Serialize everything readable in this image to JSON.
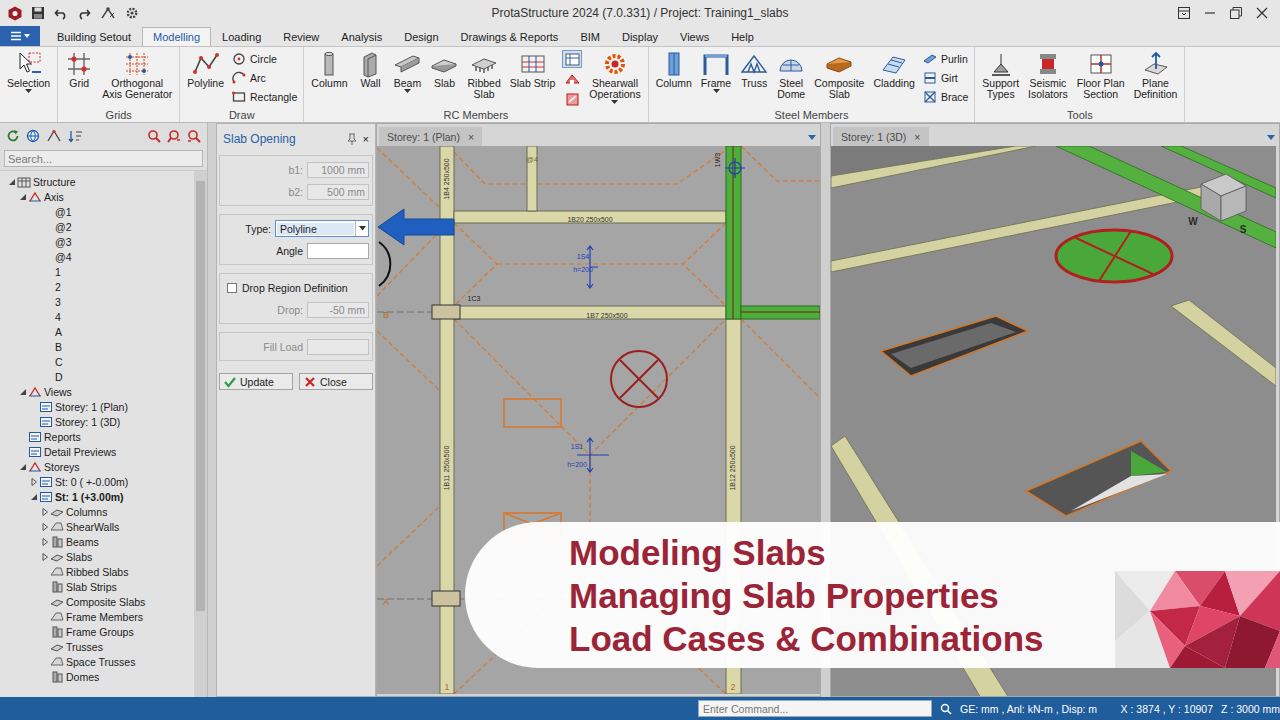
{
  "window": {
    "title": "ProtaStructure 2024 (7.0.331) / Project: Training1_slabs"
  },
  "menu_tabs": [
    {
      "label": "Building Setout",
      "selected": false
    },
    {
      "label": "Modelling",
      "selected": true
    },
    {
      "label": "Loading",
      "selected": false
    },
    {
      "label": "Review",
      "selected": false
    },
    {
      "label": "Analysis",
      "selected": false
    },
    {
      "label": "Design",
      "selected": false
    },
    {
      "label": "Drawings & Reports",
      "selected": false
    },
    {
      "label": "BIM",
      "selected": false
    },
    {
      "label": "Display",
      "selected": false
    },
    {
      "label": "Views",
      "selected": false
    },
    {
      "label": "Help",
      "selected": false
    }
  ],
  "ribbon_groups": [
    {
      "title": "",
      "items": [
        {
          "kind": "large",
          "lines": [
            "Selection"
          ],
          "dropdown": true
        }
      ]
    },
    {
      "title": "Grids",
      "items": [
        {
          "kind": "large",
          "lines": [
            "Grid"
          ],
          "dropdown": false
        },
        {
          "kind": "large",
          "lines": [
            "Orthogonal",
            "Axis Generator"
          ],
          "dropdown": false
        }
      ]
    },
    {
      "title": "Draw",
      "items": [
        {
          "kind": "large",
          "lines": [
            "Polyline"
          ],
          "dropdown": false
        },
        {
          "kind": "stack",
          "labels": [
            "Circle",
            "Arc",
            "Rectangle"
          ]
        }
      ]
    },
    {
      "title": "RC Members",
      "items": [
        {
          "kind": "large",
          "lines": [
            "Column"
          ],
          "dropdown": false
        },
        {
          "kind": "large",
          "lines": [
            "Wall"
          ],
          "dropdown": false
        },
        {
          "kind": "large",
          "lines": [
            "Beam"
          ],
          "dropdown": true
        },
        {
          "kind": "large",
          "lines": [
            "Slab"
          ],
          "dropdown": false
        },
        {
          "kind": "large",
          "lines": [
            "Ribbed",
            "Slab"
          ],
          "dropdown": false
        },
        {
          "kind": "large",
          "lines": [
            "Slab Strip"
          ],
          "dropdown": false
        },
        {
          "kind": "iconstack",
          "icons": [
            {
              "selected": true
            },
            {
              "selected": false
            },
            {
              "selected": false
            }
          ]
        },
        {
          "kind": "large",
          "lines": [
            "Shearwall",
            "Operations"
          ],
          "dropdown": true
        }
      ]
    },
    {
      "title": "Steel Members",
      "items": [
        {
          "kind": "large",
          "lines": [
            "Column"
          ],
          "dropdown": false
        },
        {
          "kind": "large",
          "lines": [
            "Frame"
          ],
          "dropdown": true
        },
        {
          "kind": "large",
          "lines": [
            "Truss"
          ],
          "dropdown": false
        },
        {
          "kind": "large",
          "lines": [
            "Steel",
            "Dome"
          ],
          "dropdown": false
        },
        {
          "kind": "large",
          "lines": [
            "Composite",
            "Slab"
          ],
          "dropdown": false
        },
        {
          "kind": "large",
          "lines": [
            "Cladding"
          ],
          "dropdown": false
        },
        {
          "kind": "stack",
          "labels": [
            "Purlin",
            "Girt",
            "Brace"
          ]
        }
      ]
    },
    {
      "title": "Tools",
      "items": [
        {
          "kind": "large",
          "lines": [
            "Support",
            "Types"
          ],
          "dropdown": false
        },
        {
          "kind": "large",
          "lines": [
            "Seismic",
            "Isolators"
          ],
          "dropdown": false
        },
        {
          "kind": "large",
          "lines": [
            "Floor Plan",
            "Section"
          ],
          "dropdown": false
        },
        {
          "kind": "large",
          "lines": [
            "Plane",
            "Definition"
          ],
          "dropdown": false
        }
      ]
    }
  ],
  "tree": {
    "search_placeholder": "Search...",
    "items": [
      {
        "label": "Structure",
        "depth": 0,
        "kind": "node",
        "expandable": true,
        "expanded": true,
        "active": false
      },
      {
        "label": "Axis",
        "depth": 1,
        "kind": "node",
        "expandable": true,
        "expanded": true,
        "active": false
      },
      {
        "label": "@1",
        "depth": 2,
        "kind": "axis",
        "expandable": false,
        "expanded": false,
        "active": false
      },
      {
        "label": "@2",
        "depth": 2,
        "kind": "axis",
        "expandable": false,
        "expanded": false,
        "active": false
      },
      {
        "label": "@3",
        "depth": 2,
        "kind": "axis",
        "expandable": false,
        "expanded": false,
        "active": false
      },
      {
        "label": "@4",
        "depth": 2,
        "kind": "axis",
        "expandable": false,
        "expanded": false,
        "active": false
      },
      {
        "label": "1",
        "depth": 2,
        "kind": "axis",
        "expandable": false,
        "expanded": false,
        "active": false
      },
      {
        "label": "2",
        "depth": 2,
        "kind": "axis",
        "expandable": false,
        "expanded": false,
        "active": false
      },
      {
        "label": "3",
        "depth": 2,
        "kind": "axis",
        "expandable": false,
        "expanded": false,
        "active": false
      },
      {
        "label": "4",
        "depth": 2,
        "kind": "axis",
        "expandable": false,
        "expanded": false,
        "active": false
      },
      {
        "label": "A",
        "depth": 2,
        "kind": "axis",
        "expandable": false,
        "expanded": false,
        "active": false
      },
      {
        "label": "B",
        "depth": 2,
        "kind": "axis",
        "expandable": false,
        "expanded": false,
        "active": false
      },
      {
        "label": "C",
        "depth": 2,
        "kind": "axis",
        "expandable": false,
        "expanded": false,
        "active": false
      },
      {
        "label": "D",
        "depth": 2,
        "kind": "axis",
        "expandable": false,
        "expanded": false,
        "active": false
      },
      {
        "label": "Views",
        "depth": 1,
        "kind": "node",
        "expandable": true,
        "expanded": true,
        "active": false
      },
      {
        "label": "Storey: 1 (Plan)",
        "depth": 2,
        "kind": "node",
        "expandable": false,
        "expanded": false,
        "active": false
      },
      {
        "label": "Storey: 1 (3D)",
        "depth": 2,
        "kind": "node",
        "expandable": false,
        "expanded": false,
        "active": false
      },
      {
        "label": "Reports",
        "depth": 1,
        "kind": "node",
        "expandable": false,
        "expanded": false,
        "active": false
      },
      {
        "label": "Detail Previews",
        "depth": 1,
        "kind": "node",
        "expandable": false,
        "expanded": false,
        "active": false
      },
      {
        "label": "Storeys",
        "depth": 1,
        "kind": "node",
        "expandable": true,
        "expanded": true,
        "active": false
      },
      {
        "label": "St: 0 ( +-0.00m)",
        "depth": 2,
        "kind": "node",
        "expandable": true,
        "expanded": false,
        "active": false
      },
      {
        "label": "St: 1 (+3.00m)",
        "depth": 2,
        "kind": "node",
        "expandable": true,
        "expanded": true,
        "active": true
      },
      {
        "label": "Columns",
        "depth": 3,
        "kind": "node",
        "expandable": true,
        "expanded": false,
        "active": false
      },
      {
        "label": "ShearWalls",
        "depth": 3,
        "kind": "node",
        "expandable": true,
        "expanded": false,
        "active": false
      },
      {
        "label": "Beams",
        "depth": 3,
        "kind": "node",
        "expandable": true,
        "expanded": false,
        "active": false
      },
      {
        "label": "Slabs",
        "depth": 3,
        "kind": "node",
        "expandable": true,
        "expanded": false,
        "active": false
      },
      {
        "label": "Ribbed Slabs",
        "depth": 3,
        "kind": "node",
        "expandable": false,
        "expanded": false,
        "active": false
      },
      {
        "label": "Slab Strips",
        "depth": 3,
        "kind": "node",
        "expandable": false,
        "expanded": false,
        "active": false
      },
      {
        "label": "Composite Slabs",
        "depth": 3,
        "kind": "node",
        "expandable": false,
        "expanded": false,
        "active": false
      },
      {
        "label": "Frame Members",
        "depth": 3,
        "kind": "node",
        "expandable": false,
        "expanded": false,
        "active": false
      },
      {
        "label": "Frame Groups",
        "depth": 3,
        "kind": "node",
        "expandable": false,
        "expanded": false,
        "active": false
      },
      {
        "label": "Trusses",
        "depth": 3,
        "kind": "node",
        "expandable": false,
        "expanded": false,
        "active": false
      },
      {
        "label": "Space Trusses",
        "depth": 3,
        "kind": "node",
        "expandable": false,
        "expanded": false,
        "active": false
      },
      {
        "label": "Domes",
        "depth": 3,
        "kind": "node",
        "expandable": false,
        "expanded": false,
        "active": false
      }
    ]
  },
  "slab_opening": {
    "title": "Slab Opening",
    "close": "×",
    "groups": [
      {
        "fields": [
          {
            "kind": "text",
            "label": "b1:",
            "value": "1000 mm",
            "disabled": true
          },
          {
            "kind": "text",
            "label": "b2:",
            "value": "500 mm",
            "disabled": true
          }
        ]
      },
      {
        "fields": [
          {
            "kind": "select",
            "label": "Type:",
            "value": "Polyline",
            "disabled": false
          },
          {
            "kind": "text",
            "label": "Angle",
            "value": "",
            "disabled": false
          }
        ]
      },
      {
        "fields": [
          {
            "kind": "checkbox",
            "label": "Drop Region Definition",
            "checked": false,
            "disabled": false
          },
          {
            "kind": "text",
            "label": "Drop:",
            "value": "-50 mm",
            "disabled": true
          }
        ]
      },
      {
        "fields": [
          {
            "kind": "text",
            "label": "Fill Load",
            "value": "",
            "disabled": true
          }
        ]
      }
    ],
    "buttons": [
      {
        "label": "Update",
        "kind": "update"
      },
      {
        "label": "Close",
        "kind": "close"
      }
    ]
  },
  "view_plan": {
    "tab": {
      "label": "Storey: 1 (Plan)",
      "close": "×",
      "selected": false
    },
    "labels": [
      {
        "text": "@4"
      },
      {
        "text": "1W3"
      },
      {
        "text": "1B20 250x500"
      },
      {
        "text": "1B4 250x500"
      },
      {
        "text": "1S4"
      },
      {
        "text": "h=200"
      },
      {
        "text": "1C3"
      },
      {
        "text": "B"
      },
      {
        "text": "1B7 250x500"
      },
      {
        "text": "1S1"
      },
      {
        "text": "h=200"
      },
      {
        "text": "1B11 250x500"
      },
      {
        "text": "1B12 250x500"
      },
      {
        "text": "A"
      },
      {
        "text": "1"
      },
      {
        "text": "2"
      }
    ]
  },
  "view_3d": {
    "tab": {
      "label": "Storey: 1 (3D)",
      "close": "×",
      "selected": false
    },
    "labels": [
      {
        "text": "W"
      },
      {
        "text": "S"
      }
    ]
  },
  "status_bar": {
    "command_placeholder": "Enter Command...",
    "units": "GE: mm , Anl: kN-m , Disp: m",
    "coords": "X : 3874 , Y : 10907",
    "z": "Z : 3000 mm"
  },
  "banner": {
    "lines": [
      "Modeling Slabs",
      "Managing Slab Properties",
      "Load Cases & Combinations"
    ]
  }
}
